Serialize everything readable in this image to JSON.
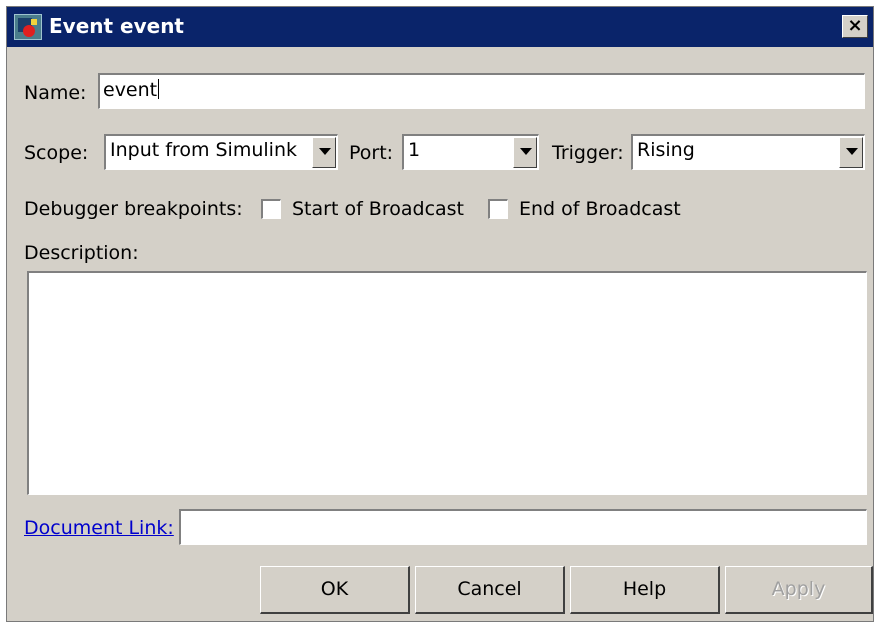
{
  "window": {
    "title": "Event event",
    "icons": {
      "app": "stateflow-app-icon",
      "close": "close-icon"
    },
    "close_glyph": "×"
  },
  "form": {
    "name": {
      "label": "Name:",
      "value": "event"
    },
    "scope": {
      "label": "Scope:",
      "value": "Input from Simulink"
    },
    "port": {
      "label": "Port:",
      "value": "1"
    },
    "trigger": {
      "label": "Trigger:",
      "value": "Rising"
    },
    "breakpoints": {
      "label": "Debugger breakpoints:",
      "start": {
        "label": "Start of Broadcast",
        "checked": false
      },
      "end": {
        "label": "End of Broadcast",
        "checked": false
      }
    },
    "description": {
      "label": "Description:",
      "value": ""
    },
    "document_link": {
      "label": "Document Link:",
      "value": ""
    }
  },
  "buttons": {
    "ok": "OK",
    "cancel": "Cancel",
    "help": "Help",
    "apply": "Apply"
  },
  "colors": {
    "titlebar": "#0a246a",
    "dialog_bg": "#d4d0c8",
    "link": "#0000cc",
    "disabled_text": "#a0a0a0"
  }
}
